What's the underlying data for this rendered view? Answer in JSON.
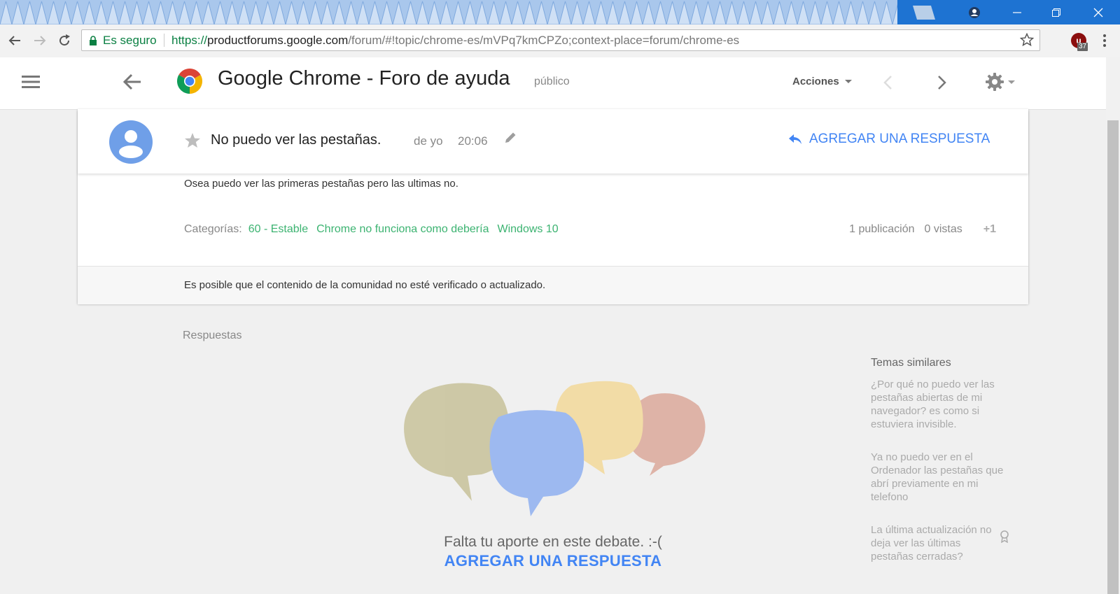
{
  "browser": {
    "secure_label": "Es seguro",
    "url_scheme": "https://",
    "url_host": "productforums.google.com",
    "url_path": "/forum/#!topic/chrome-es/mVPq7kmCPZo;context-place=forum/chrome-es",
    "extension_badge": "37",
    "extension_letter": "u"
  },
  "forum_header": {
    "title": "Google Chrome - Foro de ayuda",
    "visibility": "público",
    "actions_label": "Acciones"
  },
  "post": {
    "title": "No puedo ver las pestañas.",
    "author": "de yo",
    "time": "20:06",
    "reply_label": "AGREGAR UNA RESPUESTA",
    "body": "Osea puedo ver las primeras pestañas pero las ultimas no.",
    "categories_label": "Categorías:",
    "categories": [
      "60 - Estable",
      "Chrome no funciona como debería",
      "Windows 10"
    ],
    "publications": "1 publicación",
    "views": "0 vistas",
    "plus_one": "+1",
    "notice": "Es posible que el contenido de la comunidad no esté verificado o actualizado."
  },
  "replies": {
    "section_label": "Respuestas",
    "empty_message": "Falta tu aporte en este debate. :-(",
    "empty_reply_label": "AGREGAR UNA RESPUESTA"
  },
  "similar": {
    "title": "Temas similares",
    "items": [
      "¿Por qué no puedo ver las pestañas abiertas de mi navegador? es como si estuviera invisible.",
      "Ya no puedo ver en el Ordenador las pestañas que abrí previamente en mi telefono",
      "La última actualización no deja ver las últimas pestañas cerradas?"
    ]
  },
  "colors": {
    "accent_blue": "#4285f4",
    "category_green": "#3cb371",
    "titlebar_blue": "#1e73d2",
    "secure_green": "#0b8043"
  }
}
